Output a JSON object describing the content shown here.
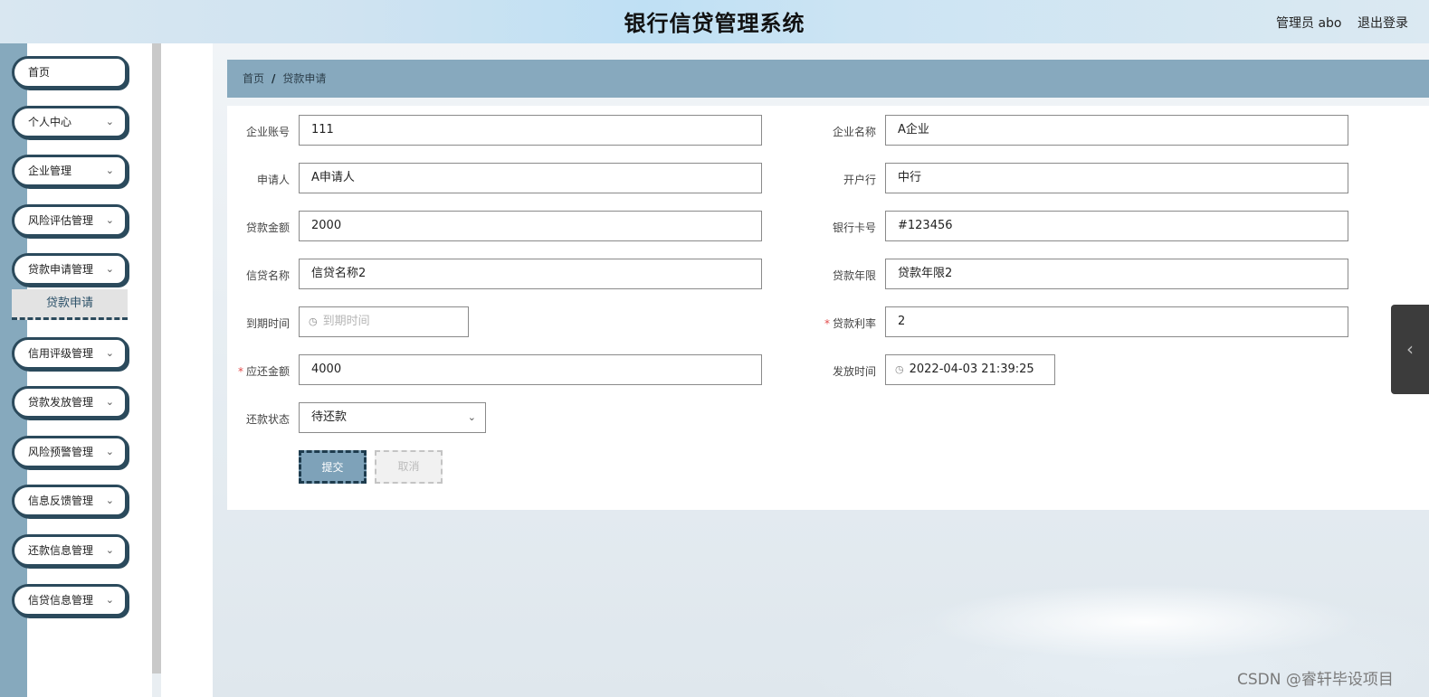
{
  "header": {
    "title": "银行信贷管理系统",
    "user": "管理员 abo",
    "logout": "退出登录"
  },
  "sidebar": {
    "items": [
      {
        "label": "首页"
      },
      {
        "label": "个人中心"
      },
      {
        "label": "企业管理"
      },
      {
        "label": "风险评估管理"
      },
      {
        "label": "贷款申请管理"
      },
      {
        "label": "信用评级管理"
      },
      {
        "label": "贷款发放管理"
      },
      {
        "label": "风险预警管理"
      },
      {
        "label": "信息反馈管理"
      },
      {
        "label": "还款信息管理"
      },
      {
        "label": "信贷信息管理"
      }
    ],
    "active_sub": "贷款申请"
  },
  "breadcrumb": {
    "home": "首页",
    "separator": "/",
    "current": "贷款申请"
  },
  "form": {
    "company_account": {
      "label": "企业账号",
      "value": "111"
    },
    "company_name": {
      "label": "企业名称",
      "value": "A企业"
    },
    "applicant": {
      "label": "申请人",
      "value": "A申请人"
    },
    "bank": {
      "label": "开户行",
      "value": "中行"
    },
    "loan_amount": {
      "label": "贷款金额",
      "value": "2000"
    },
    "card_no": {
      "label": "银行卡号",
      "value": "#123456"
    },
    "credit_name": {
      "label": "信贷名称",
      "value": "信贷名称2"
    },
    "loan_term": {
      "label": "贷款年限",
      "value": "贷款年限2"
    },
    "due_time": {
      "label": "到期时间",
      "placeholder": "到期时间"
    },
    "loan_rate": {
      "label": "贷款利率",
      "value": "2"
    },
    "repay_amount": {
      "label": "应还金额",
      "value": "4000"
    },
    "issue_time": {
      "label": "发放时间",
      "value": "2022-04-03 21:39:25"
    },
    "repay_status": {
      "label": "还款状态",
      "value": "待还款"
    },
    "required_mark": "*"
  },
  "buttons": {
    "submit": "提交",
    "cancel": "取消"
  },
  "watermark": "CSDN @睿轩毕设项目",
  "icons": {
    "chevron_down": "⌄",
    "chevron_left": "‹",
    "clock": "◷"
  },
  "colors": {
    "accent": "#87a9be",
    "menu_border": "#2b4a5c",
    "required": "#e24b4b"
  }
}
